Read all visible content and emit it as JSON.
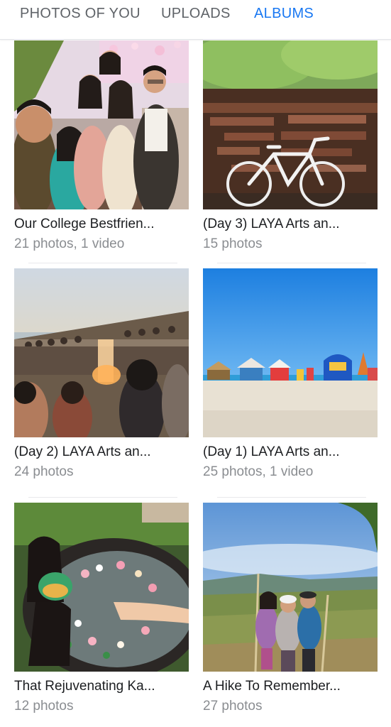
{
  "tabs": [
    {
      "label": "PHOTOS OF YOU",
      "active": false
    },
    {
      "label": "UPLOADS",
      "active": false
    },
    {
      "label": "ALBUMS",
      "active": true
    }
  ],
  "colors": {
    "accent": "#1877f2",
    "text": "#1c1e21",
    "muted": "#8a8d91"
  },
  "albums": [
    {
      "title": "Our College Bestfrien...",
      "count": "21 photos, 1 video",
      "thumbnail": "group photo of friends at an event"
    },
    {
      "title": "(Day 3) LAYA Arts an...",
      "count": "15 photos",
      "thumbnail": "white bicycle in front of wooden sign wall"
    },
    {
      "title": "(Day 2) LAYA Arts an...",
      "count": "24 photos",
      "thumbnail": "crowd on a beach at sunset"
    },
    {
      "title": "(Day 1) LAYA Arts an...",
      "count": "25 photos, 1 video",
      "thumbnail": "sandy beach with tents under blue sky"
    },
    {
      "title": "That Rejuvenating Ka...",
      "count": "12 photos",
      "thumbnail": "woman in flower petal bath tub"
    },
    {
      "title": "A Hike To Remember...",
      "count": "27 photos",
      "thumbnail": "hikers on a green hill"
    }
  ]
}
